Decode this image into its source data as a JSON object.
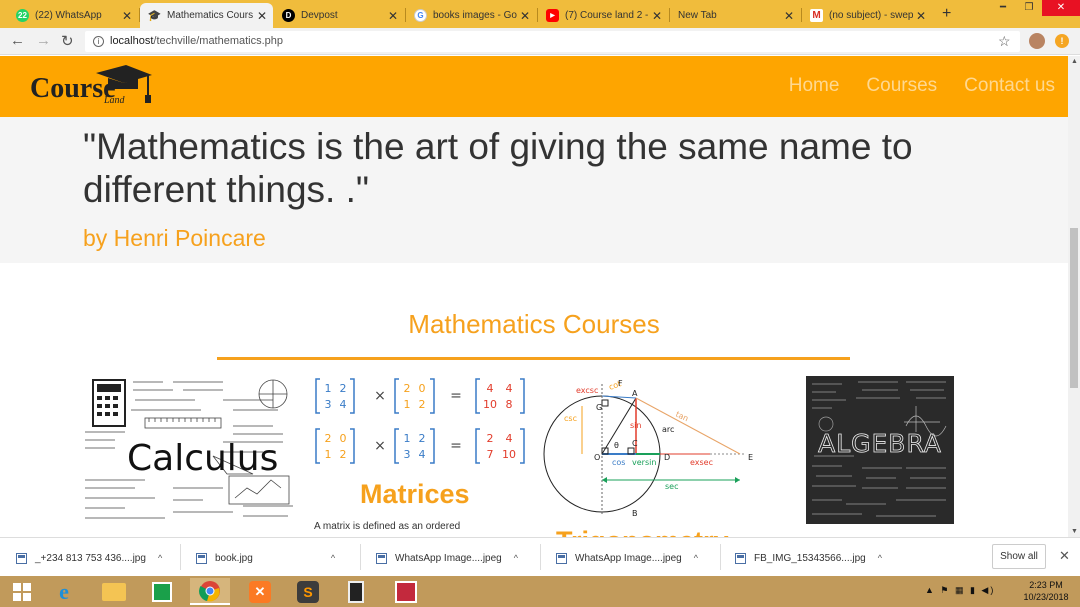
{
  "browser": {
    "tabs": [
      {
        "title": "(22) WhatsApp",
        "badge": "22",
        "icon_color": "#25d366"
      },
      {
        "title": "Mathematics Cours",
        "icon": "graduation-cap-icon"
      },
      {
        "title": "Devpost",
        "badge": "D",
        "icon_color": "#000000"
      },
      {
        "title": "books images - Go",
        "badge": "G",
        "icon_color": "#4285f4"
      },
      {
        "title": "(7) Course land 2 -",
        "badge": "▶",
        "icon_color": "#ff0000"
      },
      {
        "title": "New Tab"
      },
      {
        "title": "(no subject) - swep",
        "badge": "M",
        "icon_color": "#d93025"
      }
    ],
    "url_host": "localhost",
    "url_path": "/techville/mathematics.php"
  },
  "site": {
    "logo_text": "Course",
    "logo_sub": "Land",
    "nav": [
      "Home",
      "Courses",
      "Contact us"
    ]
  },
  "quote": {
    "text": "\"Mathematics is the art of giving the same name to different things. .\"",
    "author": "by Henri Poincare"
  },
  "courses": {
    "title": "Mathematics Courses",
    "cards": [
      {
        "title": "",
        "desc": "",
        "image_label": "Calculus"
      },
      {
        "title": "Matrices",
        "desc": "A matrix is defined as an ordered"
      },
      {
        "title": "Trigonometry",
        "desc": "",
        "image_labels": [
          "excsc",
          "cot",
          "csc",
          "sin",
          "arc",
          "tan",
          "cos",
          "versin",
          "exsec",
          "sec",
          "F",
          "A",
          "G",
          "C",
          "D",
          "E",
          "O",
          "B",
          "θ"
        ]
      },
      {
        "title": "",
        "desc": "",
        "image_label": "ALGEBRA"
      }
    ]
  },
  "matrix_equations": [
    {
      "a": [
        "1",
        "2",
        "3",
        "4"
      ],
      "b": [
        "2",
        "0",
        "1",
        "2"
      ],
      "c": [
        "4",
        "4",
        "10",
        "8"
      ]
    },
    {
      "a": [
        "2",
        "0",
        "1",
        "2"
      ],
      "b": [
        "1",
        "2",
        "3",
        "4"
      ],
      "c": [
        "2",
        "4",
        "7",
        "10"
      ]
    }
  ],
  "downloads": {
    "items": [
      "_+234 813 753 436....jpg",
      "book.jpg",
      "WhatsApp Image....jpeg",
      "WhatsApp Image....jpeg",
      "FB_IMG_15343566....jpg"
    ],
    "show_all": "Show all"
  },
  "taskbar": {
    "time": "2:23 PM",
    "date": "10/23/2018"
  },
  "colors": {
    "accent": "#fea500",
    "title_orange": "#f6a11d",
    "tab_strip": "#f0bc3c"
  }
}
